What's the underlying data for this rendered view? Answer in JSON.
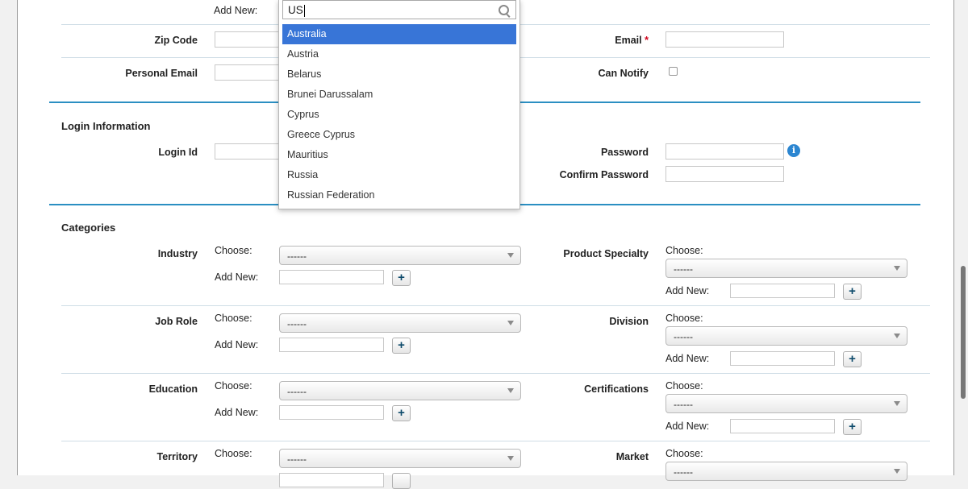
{
  "address": {
    "add_new_label": "Add New:",
    "zip_code_label": "Zip Code",
    "email_label": "Email",
    "required_mark": "*",
    "personal_email_label": "Personal Email",
    "can_notify_label": "Can Notify"
  },
  "login": {
    "title": "Login Information",
    "login_id_label": "Login Id",
    "password_label": "Password",
    "confirm_password_label": "Confirm Password",
    "info_icon": "i"
  },
  "categories": {
    "title": "Categories",
    "choose_label": "Choose:",
    "add_new_label": "Add New:",
    "placeholder_value": "------",
    "plus_label": "+",
    "rows": [
      {
        "left": "Industry",
        "right": "Product Specialty"
      },
      {
        "left": "Job Role",
        "right": "Division"
      },
      {
        "left": "Education",
        "right": "Certifications"
      },
      {
        "left": "Territory",
        "right": "Market"
      }
    ]
  },
  "country_dropdown": {
    "search_value": "US",
    "options": [
      "Australia",
      "Austria",
      "Belarus",
      "Brunei Darussalam",
      "Cyprus",
      "Greece Cyprus",
      "Mauritius",
      "Russia",
      "Russian Federation"
    ],
    "highlighted_index": 0
  }
}
